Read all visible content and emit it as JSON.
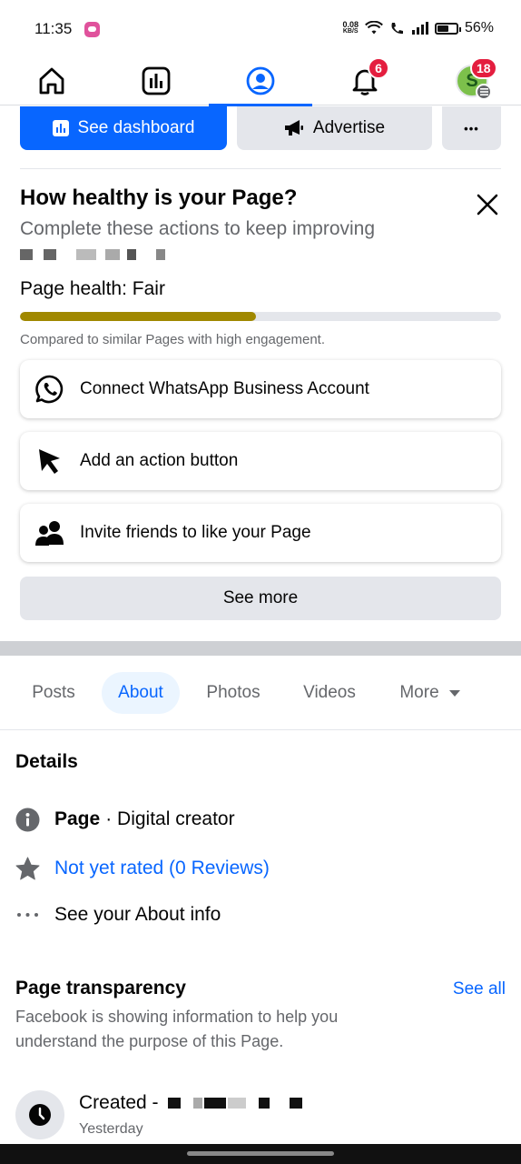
{
  "status_bar": {
    "time": "11:35",
    "net_speed_value": "0.08",
    "net_speed_unit": "KB/S",
    "battery": "56%"
  },
  "nav": {
    "notifications_badge": "6",
    "menu_badge": "18",
    "profile_initial": "S"
  },
  "actions": {
    "dashboard_label": "See dashboard",
    "advertise_label": "Advertise",
    "more_label": "•••"
  },
  "health": {
    "title": "How healthy is your Page?",
    "subtitle": "Complete these actions to keep improving",
    "status_label": "Page health:",
    "status_value": "Fair",
    "progress_fraction": 0.49,
    "progress_color": "#a08800",
    "compare_text": "Compared to similar Pages with high engagement.",
    "tasks": [
      {
        "label": "Connect WhatsApp Business Account",
        "icon": "whatsapp-icon"
      },
      {
        "label": "Add an action button",
        "icon": "cursor-icon"
      },
      {
        "label": "Invite friends to like your Page",
        "icon": "people-icon"
      }
    ],
    "see_more_label": "See more"
  },
  "tabs": [
    {
      "label": "Posts",
      "active": false
    },
    {
      "label": "About",
      "active": true
    },
    {
      "label": "Photos",
      "active": false
    },
    {
      "label": "Videos",
      "active": false
    },
    {
      "label": "More",
      "active": false
    }
  ],
  "details": {
    "title": "Details",
    "page_label": "Page",
    "page_category": "· Digital creator",
    "rating": "Not yet rated (0 Reviews)",
    "about_info": "See your About info"
  },
  "transparency": {
    "title": "Page transparency",
    "see_all": "See all",
    "description": "Facebook is showing information to help you understand the purpose of this Page.",
    "created_label": "Created -",
    "created_time": "Yesterday"
  },
  "colors": {
    "brand_blue": "#0866ff",
    "badge_red": "#e41e3f",
    "grey_button": "#e4e6eb"
  }
}
